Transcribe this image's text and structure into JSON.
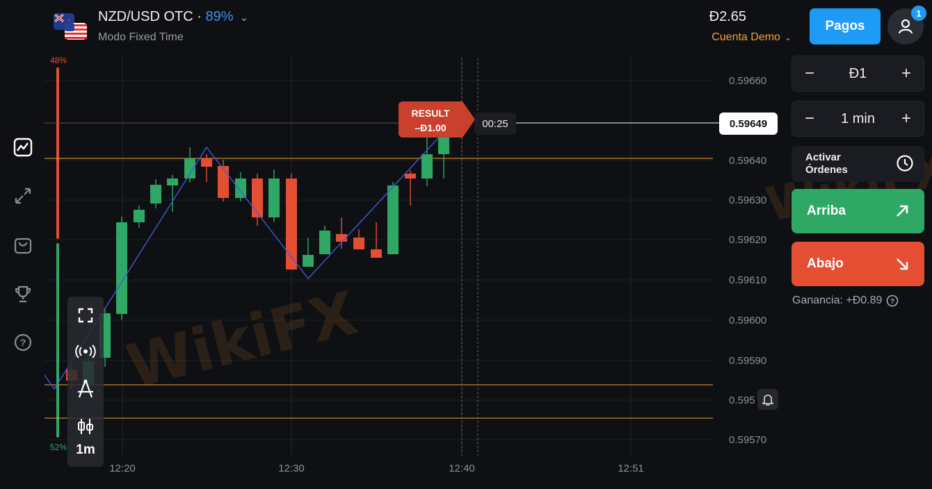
{
  "header": {
    "pair": "NZD/USD OTC",
    "separator": "·",
    "payout": "89%",
    "mode": "Modo Fixed Time",
    "balance": "Đ2.65",
    "account": "Cuenta Demo",
    "pagos_label": "Pagos",
    "notification_count": "1"
  },
  "sidebar": [
    {
      "icon": "chart-icon"
    },
    {
      "icon": "trades-arrows-icon"
    },
    {
      "icon": "shop-bag-icon"
    },
    {
      "icon": "trophy-icon"
    },
    {
      "icon": "help-icon"
    }
  ],
  "chart": {
    "sentiment_top": "48%",
    "sentiment_bottom": "52%",
    "y_ticks": [
      "0.59660",
      "0.59640",
      "0.59630",
      "0.59620",
      "0.59610",
      "0.59600",
      "0.59590",
      "0.595",
      "0.59570"
    ],
    "x_ticks": [
      "12:20",
      "12:30",
      "12:40",
      "12:51"
    ],
    "current_price": "0.59649",
    "timer": "00:25",
    "result_label": "RESULT",
    "result_value": "–Đ1.00",
    "timeframe": "1m",
    "colors": {
      "up": "#2fa866",
      "down": "#e44e33",
      "level": "#f2a33a",
      "zigzag": "#3b5bdb"
    },
    "watermark": "WikiFX"
  },
  "panel": {
    "amount": "Đ1",
    "time": "1 min",
    "minus": "−",
    "plus": "+",
    "activar": "Activar Órdenes",
    "arriba": "Arriba",
    "abajo": "Abajo",
    "profit": "Ganancia: +Đ0.89"
  }
}
